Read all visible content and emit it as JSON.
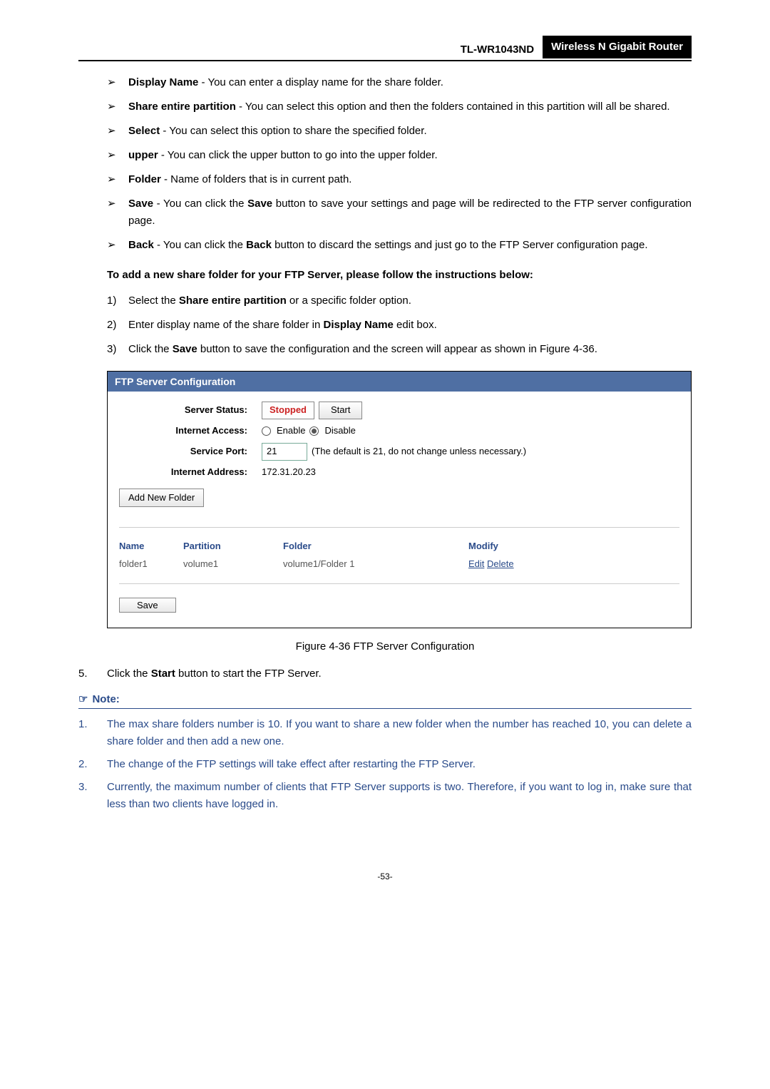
{
  "header": {
    "model": "TL-WR1043ND",
    "product": "Wireless N Gigabit Router"
  },
  "bullets": [
    {
      "term": "Display Name",
      "desc": " - You can enter a display name for the share folder."
    },
    {
      "term": "Share entire partition",
      "desc": " - You can select this option and then the folders contained in this partition will all be shared."
    },
    {
      "term": "Select",
      "desc": " - You can select this option to share the specified folder."
    },
    {
      "term": "upper",
      "desc": " - You can click the upper button to go into the upper folder."
    },
    {
      "term": "Folder",
      "desc": " - Name of folders that is in current path."
    },
    {
      "term": "Save",
      "pre": " - You can click the ",
      "mid": "Save",
      "post": " button to save your settings and page will be redirected to the FTP server configuration page."
    },
    {
      "term": "Back",
      "pre": " - You can click the ",
      "mid": "Back",
      "post": " button to discard the settings and just go to the FTP Server configuration page."
    }
  ],
  "instruction_heading": "To add a new share folder for your FTP Server, please follow the instructions below:",
  "steps": [
    {
      "pre": "Select the ",
      "bold": "Share entire partition",
      "post": " or a specific folder option."
    },
    {
      "pre": "Enter display name of the share folder in ",
      "bold": "Display Name",
      "post": " edit box."
    },
    {
      "pre": "Click the ",
      "bold": "Save",
      "post": " button to save the configuration and the screen will appear as shown in Figure 4-36."
    }
  ],
  "config": {
    "title": "FTP Server Configuration",
    "labels": {
      "server_status": "Server Status:",
      "internet_access": "Internet Access:",
      "service_port": "Service Port:",
      "internet_address": "Internet Address:"
    },
    "stopped": "Stopped",
    "start_btn": "Start",
    "enable": "Enable",
    "disable": "Disable",
    "port_value": "21",
    "port_hint": "(The default is 21, do not change unless necessary.)",
    "address": "172.31.20.23",
    "add_folder_btn": "Add New Folder",
    "table": {
      "headers": {
        "name": "Name",
        "partition": "Partition",
        "folder": "Folder",
        "modify": "Modify"
      },
      "row": {
        "name": "folder1",
        "partition": "volume1",
        "folder": "volume1/Folder 1",
        "edit": "Edit",
        "delete": "Delete"
      }
    },
    "save_btn": "Save"
  },
  "caption": "Figure 4-36 FTP Server Configuration",
  "step5": {
    "num": "5.",
    "pre": "Click the ",
    "bold": "Start",
    "post": " button to start the FTP Server."
  },
  "note": {
    "heading": "Note:",
    "items": [
      {
        "num": "1.",
        "text": "The max share folders number is 10. If you want to share a new folder when the number has reached 10, you can delete a share folder and then add a new one."
      },
      {
        "num": "2.",
        "text": "The change of the FTP settings will take effect after restarting the FTP Server."
      },
      {
        "num": "3.",
        "text": "Currently, the maximum number of clients that FTP Server supports is two. Therefore, if you want to log in, make sure that less than two clients have logged in."
      }
    ]
  },
  "page_number": "-53-"
}
